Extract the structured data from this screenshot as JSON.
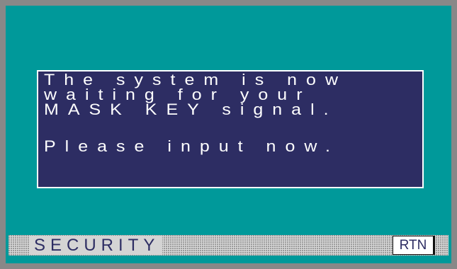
{
  "message": {
    "line1": "The system is now",
    "line2": "waiting for your",
    "line3": "MASK KEY signal.",
    "line4": "Please input now."
  },
  "footer": {
    "title": "SECURITY",
    "rtn_label": "RTN"
  },
  "colors": {
    "frame": "#888888",
    "screen_background": "#00999a",
    "message_background": "#2d2d63",
    "message_text": "#ffffff",
    "footer_text": "#2d2d63"
  }
}
